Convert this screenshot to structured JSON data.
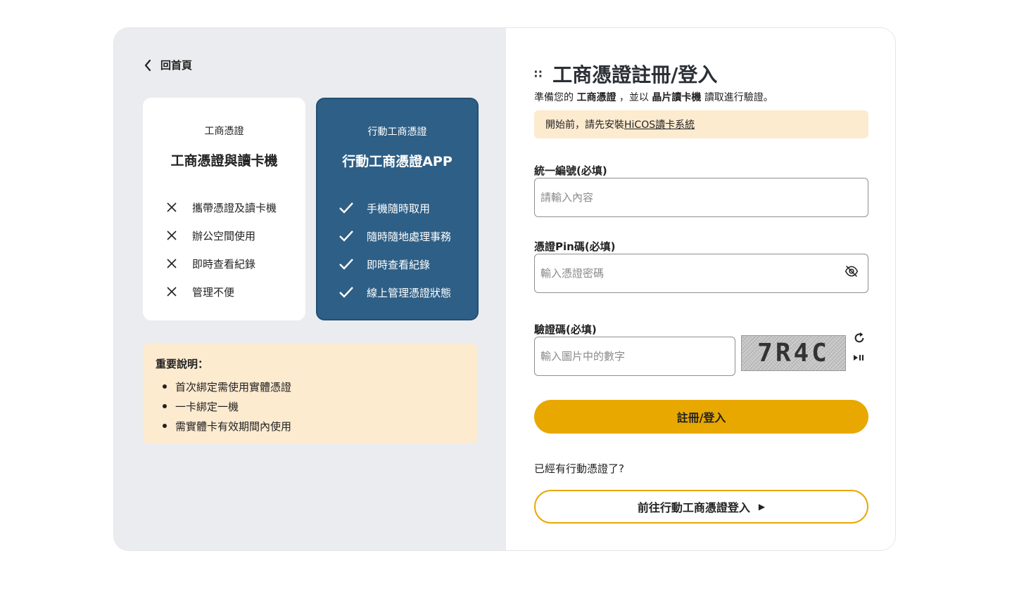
{
  "nav": {
    "back_label": "回首頁"
  },
  "option_card": {
    "subtitle": "工商憑證",
    "title": "工商憑證與讀卡機",
    "features": [
      "攜帶憑證及讀卡機",
      "辦公空間使用",
      "即時查看紀錄",
      "管理不便"
    ]
  },
  "option_app": {
    "subtitle": "行動工商憑證",
    "title": "行動工商憑證APP",
    "features": [
      "手機隨時取用",
      "隨時隨地處理事務",
      "即時查看紀錄",
      "線上管理憑證狀態"
    ]
  },
  "notice": {
    "title": "重要說明：",
    "items": [
      "首次綁定需使用實體憑證",
      "一卡綁定一機",
      "需實體卡有效期間內使用"
    ]
  },
  "form": {
    "title": "工商憑證註冊/登入",
    "intro_prefix": "準備您的",
    "intro_cert": "工商憑證",
    "intro_mid": "，並以",
    "intro_reader": "晶片讀卡機",
    "intro_suffix": "讀取進行驗證。",
    "tip_text": "開始前，請先安裝",
    "tip_link": "HiCOS讀卡系統",
    "tax_id_label": "統一編號(必填)",
    "tax_id_placeholder": "請輸入內容",
    "pin_label": "憑證Pin碼(必填)",
    "pin_placeholder": "輸入憑證密碼",
    "captcha_label": "驗證碼(必填)",
    "captcha_placeholder": "輸入圖片中的數字",
    "captcha_text": "7R4C",
    "submit_label": "註冊/登入",
    "already_text": "已經有行動憑證了?",
    "mobile_login_label": "前往行動工商憑證登入"
  },
  "colors": {
    "accent": "#e8a800",
    "app_card": "#2e5f86",
    "notice_bg": "#fdebd0"
  }
}
